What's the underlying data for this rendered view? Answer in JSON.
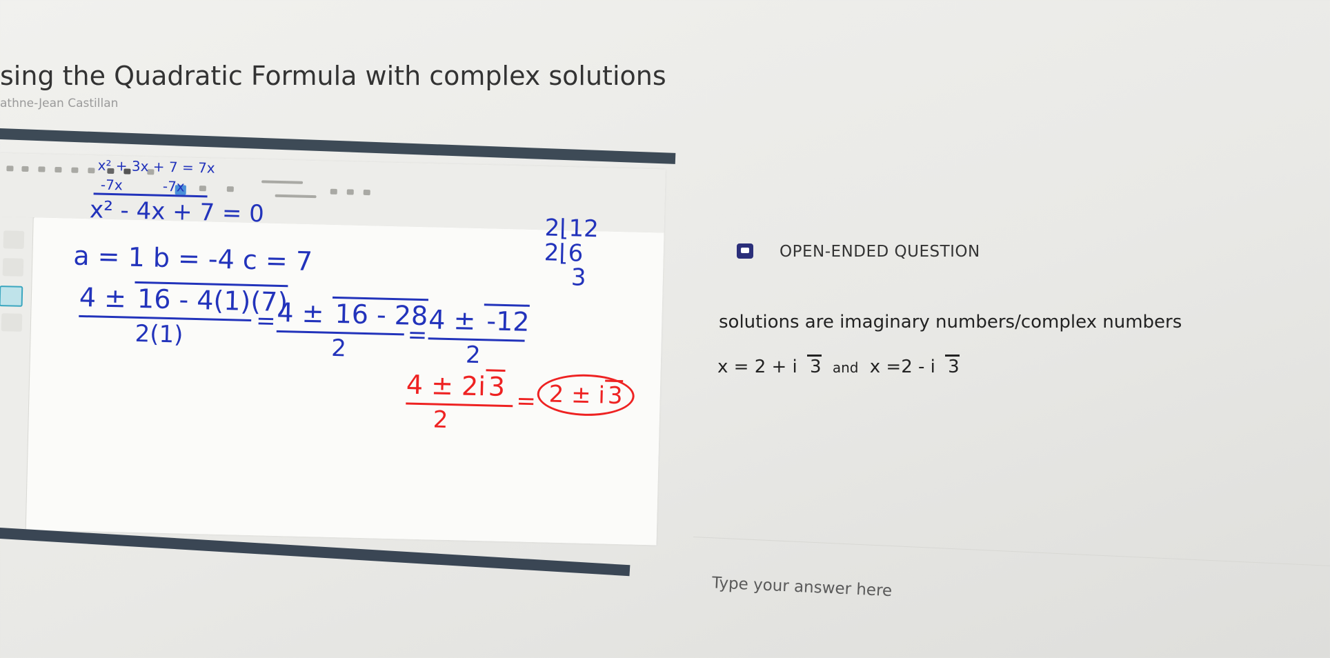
{
  "page": {
    "title": "sing the Quadratic Formula with complex solutions",
    "byline": "athne-Jean Castillan"
  },
  "whiteboard": {
    "line1": "x² + 3x + 7 = 7x",
    "line2_left": "-7x",
    "line2_right": "-7x",
    "line3": "x² - 4x + 7 = 0",
    "coefficients": "a = 1   b = -4   c = 7",
    "formula_step1_num_a": "4 ± ",
    "formula_step1_num_b": "16 - 4(1)(7)",
    "formula_step1_den": "2(1)",
    "formula_step2_num_a": "4 ± ",
    "formula_step2_num_b": "16 - 28",
    "formula_step2_den": "2",
    "formula_step3_num_a": "4 ± ",
    "formula_step3_num_b": "-12",
    "formula_step3_den": "2",
    "factor_a": "2⌊12",
    "factor_b": "2⌊6",
    "factor_c": "3",
    "simplify_num_a": "4 ± 2i",
    "simplify_num_b": "3",
    "simplify_den": "2",
    "final_a": "2 ± i",
    "final_b": "3",
    "eq1": "=",
    "eq2": "=",
    "eq3": "="
  },
  "question": {
    "type_label": "OPEN-ENDED QUESTION",
    "prompt": "solutions are imaginary numbers/complex numbers",
    "x1": "x = 2 + i",
    "x1_root": "3",
    "conj": "and",
    "x2": "x =2 - i",
    "x2_root": "3",
    "answer_placeholder": "Type your answer here"
  },
  "colors": {
    "ink_blue": "#2233bb",
    "ink_red": "#ee2222",
    "bar": "#3d4a56",
    "accent": "#2b2f7a"
  }
}
